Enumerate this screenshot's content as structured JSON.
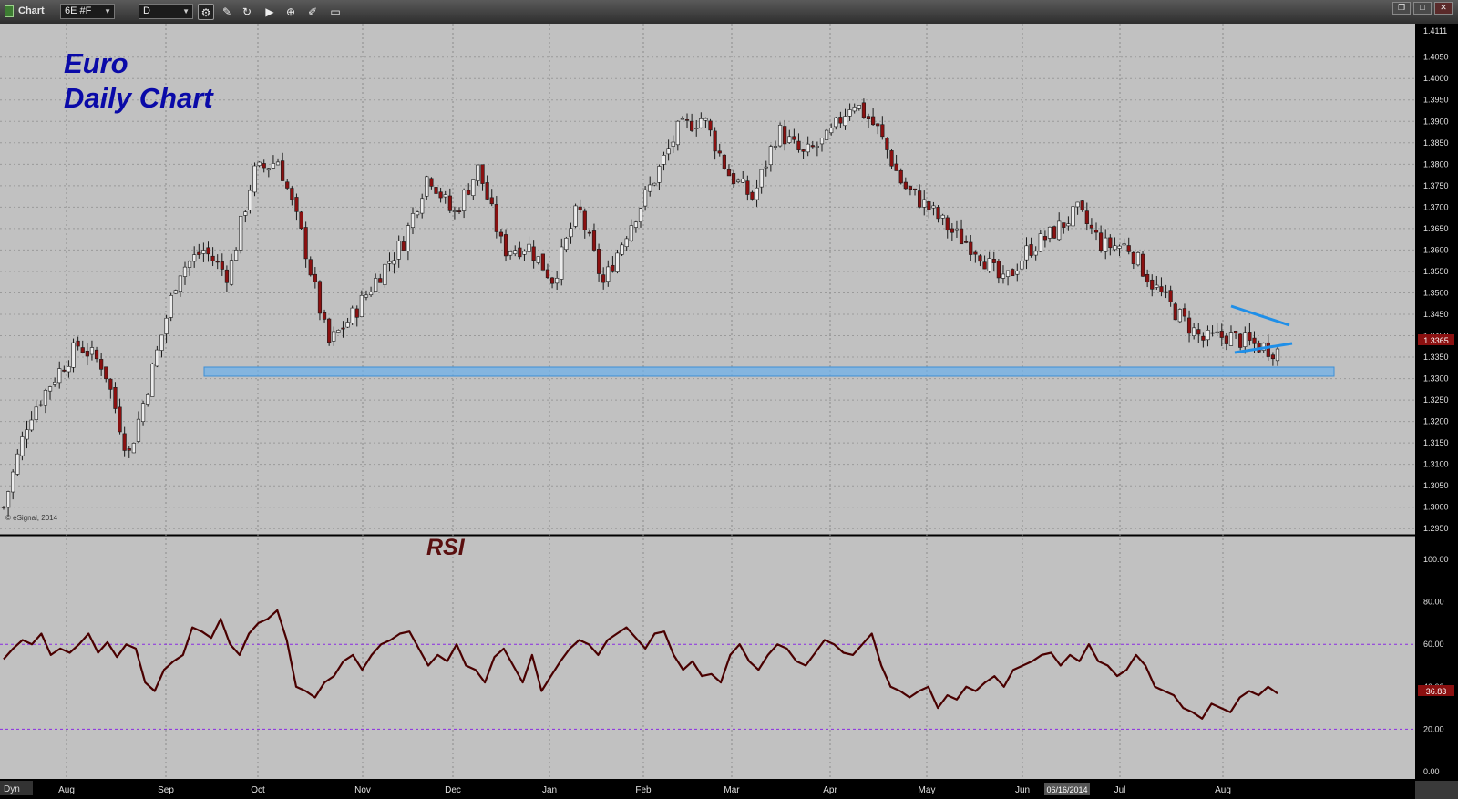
{
  "window": {
    "app_name": "Chart",
    "symbol": "6E #F",
    "interval": "D",
    "icons": [
      "settings-icon",
      "pencil-icon",
      "refresh-icon",
      "play-icon",
      "zoom-icon",
      "tools-icon",
      "window-icon",
      "restore-icon",
      "maximize-icon",
      "close-icon"
    ]
  },
  "overlay": {
    "title_line1": "Euro",
    "title_line2": "Daily Chart",
    "rsi_label": "RSI",
    "copyright": "© eSignal, 2014",
    "title_color": "#0a0aa8",
    "rsi_label_color": "#5a0f0f"
  },
  "status": {
    "mode": "Dyn",
    "date_marker": "06/16/2014"
  },
  "chart_data": [
    {
      "type": "candlestick",
      "title": "Euro Daily Chart",
      "ylim": [
        1.2925,
        1.4111
      ],
      "y_ticks": [
        "1.4111",
        "1.4050",
        "1.4000",
        "1.3950",
        "1.3900",
        "1.3850",
        "1.3800",
        "1.3750",
        "1.3700",
        "1.3650",
        "1.3600",
        "1.3550",
        "1.3500",
        "1.3450",
        "1.3400",
        "1.3350",
        "1.3300",
        "1.3250",
        "1.3200",
        "1.3150",
        "1.3100",
        "1.3050",
        "1.3000",
        "1.2950"
      ],
      "x_ticks": [
        "Aug",
        "Sep",
        "Oct",
        "Nov",
        "Dec",
        "Jan",
        "Feb",
        "Mar",
        "Apr",
        "May",
        "Jun",
        "Jul",
        "Aug"
      ],
      "close_path": [
        {
          "month": "Jul",
          "close": 1.3
        },
        {
          "month": "Aug",
          "close": 1.321
        },
        {
          "month": "Aug",
          "close": 1.33
        },
        {
          "month": "Aug",
          "close": 1.338
        },
        {
          "month": "Sep",
          "close": 1.333
        },
        {
          "month": "Sep",
          "close": 1.312
        },
        {
          "month": "Sep",
          "close": 1.333
        },
        {
          "month": "Oct",
          "close": 1.355
        },
        {
          "month": "Oct",
          "close": 1.36
        },
        {
          "month": "Oct",
          "close": 1.354
        },
        {
          "month": "Oct",
          "close": 1.378
        },
        {
          "month": "Oct",
          "close": 1.381
        },
        {
          "month": "Nov",
          "close": 1.362
        },
        {
          "month": "Nov",
          "close": 1.338
        },
        {
          "month": "Nov",
          "close": 1.345
        },
        {
          "month": "Nov",
          "close": 1.354
        },
        {
          "month": "Dec",
          "close": 1.362
        },
        {
          "month": "Dec",
          "close": 1.378
        },
        {
          "month": "Dec",
          "close": 1.368
        },
        {
          "month": "Dec",
          "close": 1.379
        },
        {
          "month": "Jan",
          "close": 1.36
        },
        {
          "month": "Jan",
          "close": 1.361
        },
        {
          "month": "Jan",
          "close": 1.353
        },
        {
          "month": "Jan",
          "close": 1.37
        },
        {
          "month": "Feb",
          "close": 1.352
        },
        {
          "month": "Feb",
          "close": 1.365
        },
        {
          "month": "Feb",
          "close": 1.376
        },
        {
          "month": "Mar",
          "close": 1.388
        },
        {
          "month": "Mar",
          "close": 1.391
        },
        {
          "month": "Mar",
          "close": 1.378
        },
        {
          "month": "Mar",
          "close": 1.372
        },
        {
          "month": "Apr",
          "close": 1.388
        },
        {
          "month": "Apr",
          "close": 1.382
        },
        {
          "month": "Apr",
          "close": 1.386
        },
        {
          "month": "May",
          "close": 1.395
        },
        {
          "month": "May",
          "close": 1.388
        },
        {
          "month": "May",
          "close": 1.375
        },
        {
          "month": "May",
          "close": 1.37
        },
        {
          "month": "May",
          "close": 1.364
        },
        {
          "month": "Jun",
          "close": 1.36
        },
        {
          "month": "Jun",
          "close": 1.352
        },
        {
          "month": "Jun",
          "close": 1.36
        },
        {
          "month": "Jun",
          "close": 1.364
        },
        {
          "month": "Jul",
          "close": 1.369
        },
        {
          "month": "Jul",
          "close": 1.361
        },
        {
          "month": "Jul",
          "close": 1.361
        },
        {
          "month": "Jul",
          "close": 1.352
        },
        {
          "month": "Jul",
          "close": 1.345
        },
        {
          "month": "Aug",
          "close": 1.339
        },
        {
          "month": "Aug",
          "close": 1.34
        },
        {
          "month": "Aug",
          "close": 1.338
        },
        {
          "month": "Aug",
          "close": 1.3365
        }
      ],
      "last_price": "1.3365",
      "support_zone": [
        1.3305,
        1.3325
      ],
      "triangle": {
        "upper": [
          1.3445,
          1.3405
        ],
        "lower": [
          1.334,
          1.336
        ]
      },
      "colors": {
        "up": "#ececec",
        "down": "#8b1010",
        "zone": "#6fb0e8",
        "triangle": "#1f8fe8",
        "background": "#c1c1c1"
      }
    },
    {
      "type": "line",
      "title": "RSI",
      "ylim": [
        0,
        100
      ],
      "y_ticks": [
        "100.00",
        "80.00",
        "60.00",
        "40.00",
        "20.00",
        "0.00"
      ],
      "reference_lines": [
        60,
        20
      ],
      "series": [
        {
          "values": [
            53,
            58,
            62,
            60,
            65,
            55,
            58,
            56,
            60,
            65,
            56,
            61,
            54,
            60,
            58,
            42,
            38,
            48,
            52,
            55,
            68,
            66,
            63,
            72,
            60,
            55,
            65,
            70,
            72,
            76,
            62,
            40,
            38,
            35,
            42,
            45,
            52,
            55,
            48,
            55,
            60,
            62,
            65,
            66,
            58,
            50,
            55,
            52,
            60,
            50,
            48,
            42,
            54,
            58,
            50,
            42,
            55,
            38,
            45,
            52,
            58,
            62,
            60,
            55,
            62,
            65,
            68,
            63,
            58,
            65,
            66,
            55,
            48,
            52,
            45,
            46,
            42,
            55,
            60,
            52,
            48,
            55,
            60,
            58,
            52,
            50,
            56,
            62,
            60,
            56,
            55,
            60,
            65,
            50,
            40,
            38,
            35,
            38,
            40,
            30,
            36,
            34,
            40,
            38,
            42,
            45,
            40,
            48,
            50,
            52,
            55,
            56,
            50,
            55,
            52,
            60,
            52,
            50,
            45,
            48,
            55,
            50,
            40,
            38,
            36,
            30,
            28,
            25,
            32,
            30,
            28,
            35,
            38,
            36,
            40,
            36.83
          ]
        }
      ],
      "last_value": "36.83",
      "colors": {
        "line": "#4a0000",
        "reference": "#8a2be2"
      }
    }
  ]
}
